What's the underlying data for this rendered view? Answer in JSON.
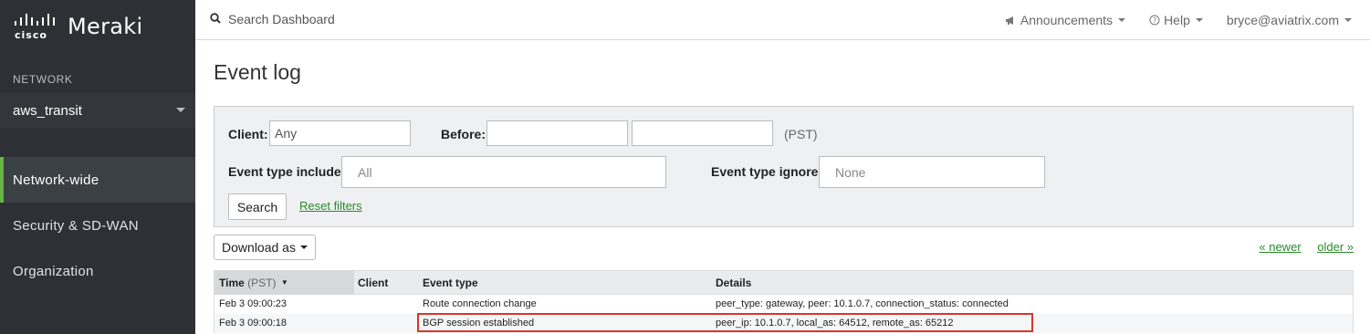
{
  "brand": {
    "cisco_word": "cisco",
    "product": "Meraki"
  },
  "sidebar": {
    "network_label": "NETWORK",
    "network_selected": "aws_transit",
    "items": [
      {
        "label": "Network-wide",
        "active": true
      },
      {
        "label": "Security & SD-WAN",
        "active": false
      },
      {
        "label": "Organization",
        "active": false
      }
    ]
  },
  "topbar": {
    "search_placeholder": "Search Dashboard",
    "announcements": "Announcements",
    "help": "Help",
    "user": "bryce@aviatrix.com"
  },
  "page": {
    "title": "Event log"
  },
  "filters": {
    "client_label": "Client:",
    "client_value": "Any",
    "before_label": "Before:",
    "before_date": "",
    "before_time": "",
    "timezone": "(PST)",
    "include_label": "Event type include:",
    "include_placeholder": "All",
    "ignore_label": "Event type ignore:",
    "ignore_placeholder": "None",
    "search_button": "Search",
    "reset_link": "Reset filters"
  },
  "toolbar": {
    "download_label": "Download as"
  },
  "pager": {
    "newer": "« newer",
    "older": "older »"
  },
  "table": {
    "columns": {
      "time": "Time",
      "time_unit": "(PST)",
      "sort_glyph": "▼",
      "client": "Client",
      "event_type": "Event type",
      "details": "Details"
    },
    "rows": [
      {
        "time": "Feb 3 09:00:23",
        "client": "",
        "event_type": "Route connection change",
        "details": "peer_type: gateway, peer: 10.1.0.7, connection_status: connected"
      },
      {
        "time": "Feb 3 09:00:18",
        "client": "",
        "event_type": "BGP session established",
        "details": "peer_ip: 10.1.0.7, local_as: 64512, remote_as: 65212"
      }
    ]
  },
  "colors": {
    "sidebar_bg": "#2d3135",
    "active_accent": "#67b346",
    "link": "#2a8a2a",
    "highlight": "#d9342b"
  },
  "icons": {
    "search": "search-icon",
    "announcements": "megaphone-icon",
    "help": "help-circle-icon"
  }
}
